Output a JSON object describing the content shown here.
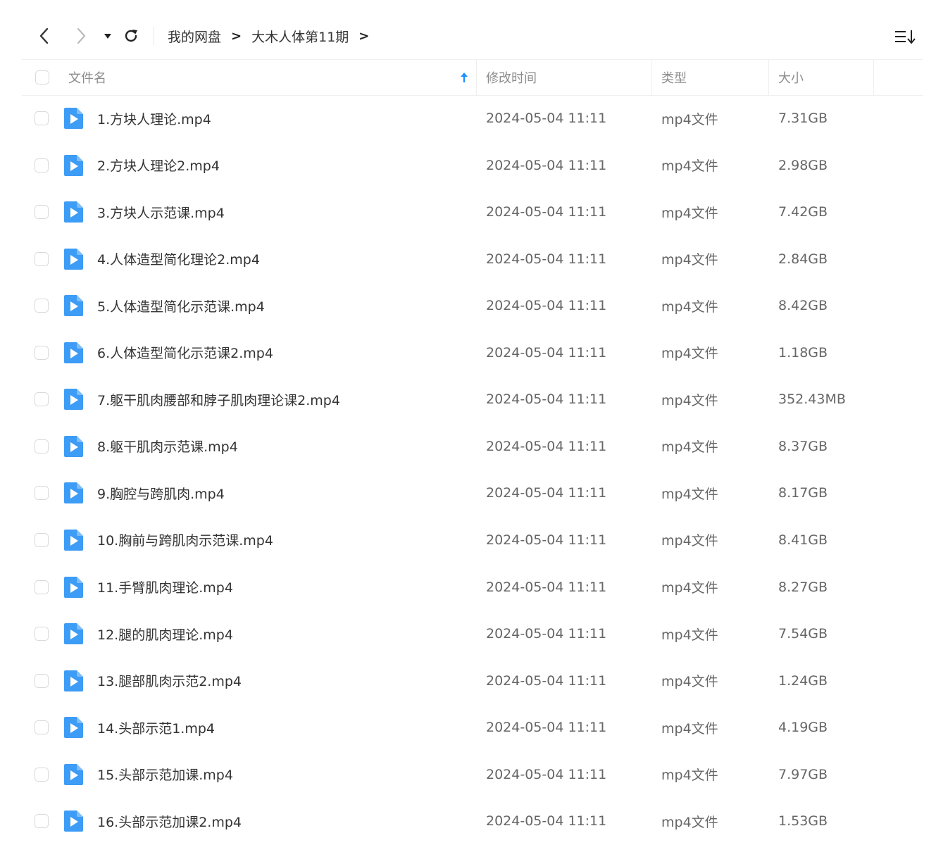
{
  "toolbar": {
    "back_icon": "chevron-left-icon",
    "forward_icon": "chevron-right-icon",
    "dropdown_icon": "caret-down-icon",
    "refresh_icon": "refresh-icon",
    "sort_icon": "sort-list-icon",
    "breadcrumb": [
      {
        "label": "我的网盘"
      },
      {
        "label": "大木人体第11期"
      }
    ],
    "breadcrumb_separator": ">"
  },
  "columns": {
    "name": "文件名",
    "modified": "修改时间",
    "type": "类型",
    "size": "大小",
    "sort_indicator_icon": "arrow-up-icon"
  },
  "colors": {
    "accent": "#1e90ff",
    "file_icon": "#3d9cf5",
    "text": "#333333",
    "meta_text": "#666666",
    "header_text": "#8c8c8c"
  },
  "files": [
    {
      "name": "1.方块人理论.mp4",
      "modified": "2024-05-04 11:11",
      "type": "mp4文件",
      "size": "7.31GB"
    },
    {
      "name": "2.方块人理论2.mp4",
      "modified": "2024-05-04 11:11",
      "type": "mp4文件",
      "size": "2.98GB"
    },
    {
      "name": "3.方块人示范课.mp4",
      "modified": "2024-05-04 11:11",
      "type": "mp4文件",
      "size": "7.42GB"
    },
    {
      "name": "4.人体造型简化理论2.mp4",
      "modified": "2024-05-04 11:11",
      "type": "mp4文件",
      "size": "2.84GB"
    },
    {
      "name": "5.人体造型简化示范课.mp4",
      "modified": "2024-05-04 11:11",
      "type": "mp4文件",
      "size": "8.42GB"
    },
    {
      "name": "6.人体造型简化示范课2.mp4",
      "modified": "2024-05-04 11:11",
      "type": "mp4文件",
      "size": "1.18GB"
    },
    {
      "name": "7.躯干肌肉腰部和脖子肌肉理论课2.mp4",
      "modified": "2024-05-04 11:11",
      "type": "mp4文件",
      "size": "352.43MB"
    },
    {
      "name": "8.躯干肌肉示范课.mp4",
      "modified": "2024-05-04 11:11",
      "type": "mp4文件",
      "size": "8.37GB"
    },
    {
      "name": "9.胸腔与跨肌肉.mp4",
      "modified": "2024-05-04 11:11",
      "type": "mp4文件",
      "size": "8.17GB"
    },
    {
      "name": "10.胸前与跨肌肉示范课.mp4",
      "modified": "2024-05-04 11:11",
      "type": "mp4文件",
      "size": "8.41GB"
    },
    {
      "name": "11.手臂肌肉理论.mp4",
      "modified": "2024-05-04 11:11",
      "type": "mp4文件",
      "size": "8.27GB"
    },
    {
      "name": "12.腿的肌肉理论.mp4",
      "modified": "2024-05-04 11:11",
      "type": "mp4文件",
      "size": "7.54GB"
    },
    {
      "name": "13.腿部肌肉示范2.mp4",
      "modified": "2024-05-04 11:11",
      "type": "mp4文件",
      "size": "1.24GB"
    },
    {
      "name": "14.头部示范1.mp4",
      "modified": "2024-05-04 11:11",
      "type": "mp4文件",
      "size": "4.19GB"
    },
    {
      "name": "15.头部示范加课.mp4",
      "modified": "2024-05-04 11:11",
      "type": "mp4文件",
      "size": "7.97GB"
    },
    {
      "name": "16.头部示范加课2.mp4",
      "modified": "2024-05-04 11:11",
      "type": "mp4文件",
      "size": "1.53GB"
    }
  ]
}
